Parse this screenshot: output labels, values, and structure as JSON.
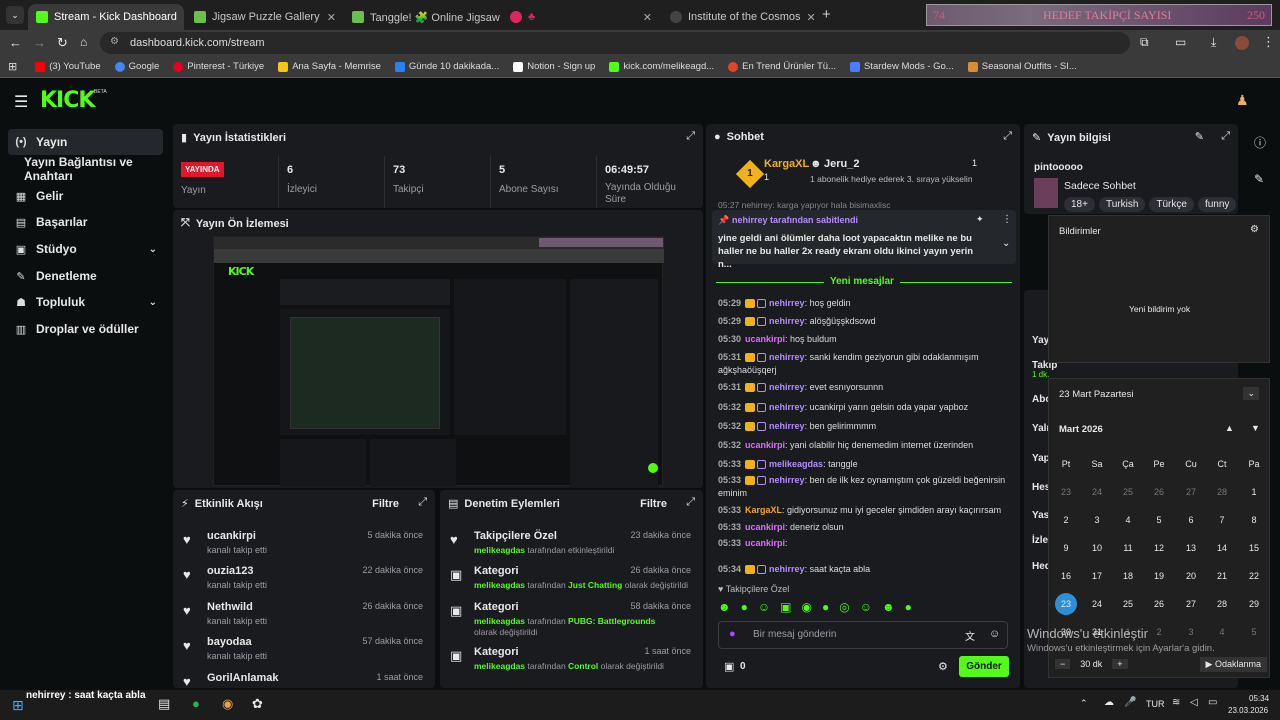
{
  "browser": {
    "tabs": [
      {
        "label": "Stream - Kick Dashboard",
        "color": "#53fc18"
      },
      {
        "label": "Jigsaw Puzzle Gallery",
        "color": "#6bbf4e"
      },
      {
        "label": "Tanggle! 🧩 Online Jigsaw Puzz",
        "color": "#6bbf4e"
      },
      {
        "label": "♣",
        "color": "#e0245e"
      },
      {
        "label": "Institute of the Cosmos",
        "color": "#444"
      }
    ],
    "overlay_left": "74",
    "overlay_title": "HEDEF TAKİPÇİ SAYISI",
    "overlay_right": "250",
    "url": "dashboard.kick.com/stream",
    "bookmarks": [
      {
        "label": "(3) YouTube",
        "color": "#ff0000"
      },
      {
        "label": "Google",
        "color": "#4285f4"
      },
      {
        "label": "Pinterest - Türkiye",
        "color": "#e60023"
      },
      {
        "label": "Ana Sayfa - Memrise",
        "color": "#f5c518"
      },
      {
        "label": "Günde 10 dakikada...",
        "color": "#2d7ff9"
      },
      {
        "label": "Notion - Sign up",
        "color": "#ffffff"
      },
      {
        "label": "kick.com/melikeagd...",
        "color": "#53fc18"
      },
      {
        "label": "En Trend Ürünler Tü...",
        "color": "#e4442b"
      },
      {
        "label": "Stardew Mods - Go...",
        "color": "#4a7dff"
      },
      {
        "label": "Seasonal Outfits - SI...",
        "color": "#d98c3a"
      }
    ]
  },
  "kick": {
    "logo": "KICK",
    "beta": "BETA",
    "sidebar": [
      {
        "label": "Yayın",
        "icon": "(•)"
      },
      {
        "label": "Yayın Bağlantısı ve Anahtarı",
        "icon": ""
      },
      {
        "label": "Gelir",
        "icon": "▦"
      },
      {
        "label": "Başarılar",
        "icon": "▤"
      },
      {
        "label": "Stüdyo",
        "icon": "▣"
      },
      {
        "label": "Denetleme",
        "icon": "✎"
      },
      {
        "label": "Topluluk",
        "icon": "☗"
      },
      {
        "label": "Droplar ve ödüller",
        "icon": "▥"
      }
    ],
    "stats": {
      "title": "Yayın İstatistikleri",
      "items": [
        {
          "value": "YAYINDA",
          "label": "Yayın"
        },
        {
          "value": "6",
          "label": "İzleyici"
        },
        {
          "value": "73",
          "label": "Takipçi"
        },
        {
          "value": "5",
          "label": "Abone Sayısı"
        },
        {
          "value": "06:49:57",
          "label": "Yayında Olduğu Süre"
        }
      ]
    },
    "preview": {
      "title": "Yayın Ön İzlemesi"
    },
    "activity": {
      "title": "Etkinlik Akışı",
      "filter": "Filtre",
      "rows": [
        {
          "name": "ucankirpi",
          "desc": "kanalı takip etti",
          "time": "5 dakika önce"
        },
        {
          "name": "ouzia123",
          "desc": "kanalı takip etti",
          "time": "22 dakika önce"
        },
        {
          "name": "Nethwild",
          "desc": "kanalı takip etti",
          "time": "26 dakika önce"
        },
        {
          "name": "bayodaa",
          "desc": "kanalı takip etti",
          "time": "57 dakika önce"
        },
        {
          "name": "GorilAnlamak",
          "desc": "",
          "time": "1 saat önce"
        }
      ]
    },
    "moderation": {
      "title": "Denetim Eylemleri",
      "filter": "Filtre",
      "rows": [
        {
          "name": "Takipçilere Özel",
          "actor": "melikeagdas",
          "text": " tarafından etkinleştirildi",
          "extra": "",
          "extra2": "",
          "time": "23 dakika önce"
        },
        {
          "name": "Kategori",
          "actor": "melikeagdas",
          "text": " tarafından ",
          "extra": "Just Chatting",
          "extra2": " olarak değiştirildi",
          "time": "26 dakika önce"
        },
        {
          "name": "Kategori",
          "actor": "melikeagdas",
          "text": " tarafından ",
          "extra": "PUBG: Battlegrounds",
          "extra2": " olarak değiştirildi",
          "time": "58 dakika önce"
        },
        {
          "name": "Kategori",
          "actor": "melikeagdas",
          "text": " tarafından ",
          "extra": "Control",
          "extra2": " olarak değiştirildi",
          "time": "1 saat önce"
        }
      ]
    },
    "chat": {
      "title": "Sohbet",
      "gifter": {
        "rank": "1",
        "name": "KargaXL",
        "count": "1",
        "user2": "Jeru_2",
        "count2": "1",
        "sub": "1 abonelik hediye ederek 3. sıraya yükselin"
      },
      "partial": "05:27 nehirrey: karga yapıyor hala bisimaxlisc",
      "pinned_by": "nehirrey tarafından sabitlendi",
      "pinned_text": "yine geldi ani ölümler daha loot yapacaktın melike ne bu haller ne bu haller 2x ready ekranı oldu ikinci yayın yerin n...",
      "new_messages": "Yeni mesajlar",
      "messages": [
        {
          "time": "05:29",
          "user": "nehirrey",
          "text": ": hoş geldin",
          "style": "nm"
        },
        {
          "time": "05:29",
          "user": "nehirrey",
          "text": ": alöşğüşşkdsowd",
          "style": "nm"
        },
        {
          "time": "05:30",
          "user": "ucankirpi",
          "text": ": hoş buldum",
          "style": "nm2"
        },
        {
          "time": "05:31",
          "user": "nehirrey",
          "text": ": sanki kendim geziyorun gibi odaklanmışım ağkşhaöüşqerj",
          "style": "nm"
        },
        {
          "time": "05:31",
          "user": "nehirrey",
          "text": ": evet esnıyorsunnn",
          "style": "nm"
        },
        {
          "time": "05:32",
          "user": "nehirrey",
          "text": ": ucankirpi yarın gelsin oda yapar yapboz",
          "style": "nm"
        },
        {
          "time": "05:32",
          "user": "nehirrey",
          "text": ": ben gelirimmmm",
          "style": "nm"
        },
        {
          "time": "05:32",
          "user": "ucankirpi",
          "text": ": yani olabilir hiç denemedim internet üzerinden",
          "style": "nm2"
        },
        {
          "time": "05:33",
          "user": "melikeagdas",
          "text": ": tanggle",
          "style": "nm"
        },
        {
          "time": "05:33",
          "user": "nehirrey",
          "text": ": ben de ilk kez oynamıştım çok güzeldi beğenirsin eminim",
          "style": "nm"
        },
        {
          "time": "05:33",
          "user": "KargaXL",
          "text": ": gidiyorsunuz mu iyi geceler şimdiden arayı kaçırırsam",
          "style": "nm3"
        },
        {
          "time": "05:33",
          "user": "ucankirpi",
          "text": ": deneriz olsun",
          "style": "nm2"
        },
        {
          "time": "05:33",
          "user": "ucankirpi",
          "text": ":",
          "style": "nm2"
        },
        {
          "time": "05:34",
          "user": "nehirrey",
          "text": ": saat kaçta abla",
          "style": "nm"
        }
      ],
      "followers_only": "Takipçilere Özel",
      "input_placeholder": "Bir mesaj gönderin",
      "points": "0",
      "send": "Gönder"
    },
    "info": {
      "title": "Yayın bilgisi",
      "channel": "pintooooo",
      "stream_title": "Sadece Sohbet",
      "tags": [
        "18+",
        "Turkish",
        "Türkçe",
        "funny"
      ],
      "partial_labels": [
        "Yay",
        "Takip",
        "1 dk.",
        "Abo",
        "Yaln",
        "Yap",
        "Hes",
        "Yas",
        "İzle",
        "Hed"
      ]
    }
  },
  "notifications": {
    "title": "Bildirimler",
    "empty": "Yeni bildirim yok",
    "date_label": "23 Mart Pazartesi",
    "month": "Mart 2026",
    "weekdays": [
      "Pt",
      "Sa",
      "Ça",
      "Pe",
      "Cu",
      "Ct",
      "Pa"
    ],
    "days": [
      [
        "23",
        "24",
        "25",
        "26",
        "27",
        "28",
        "1"
      ],
      [
        "2",
        "3",
        "4",
        "5",
        "6",
        "7",
        "8"
      ],
      [
        "9",
        "10",
        "11",
        "12",
        "13",
        "14",
        "15"
      ],
      [
        "16",
        "17",
        "18",
        "19",
        "20",
        "21",
        "22"
      ],
      [
        "23",
        "24",
        "25",
        "26",
        "27",
        "28",
        "29"
      ],
      [
        "30",
        "31",
        "1",
        "2",
        "3",
        "4",
        "5"
      ]
    ],
    "today": "23",
    "focus_minutes": "30 dk",
    "focus_label": "Odaklanma",
    "activate_title": "Windows'u etkinleştir",
    "activate_sub": "Windows'u etkinleştirmek için Ayarlar'a gidin."
  },
  "taskbar": {
    "toast": "nehirrey : saat kaçta abla",
    "lang": "TUR",
    "time": "05:34",
    "date": "23.03.2026"
  }
}
